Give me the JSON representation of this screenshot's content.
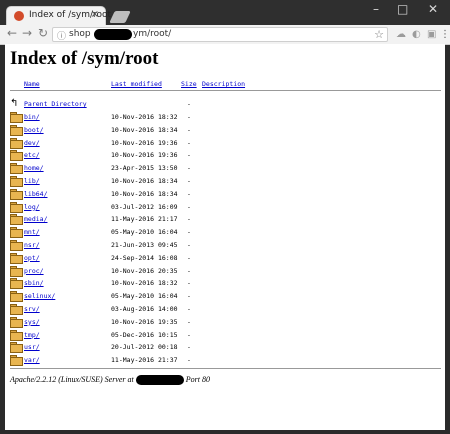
{
  "browser": {
    "tab_title": "Index of /sym/root",
    "tab_close": "×",
    "url_prefix": "shop",
    "url_suffix": "ym/root/",
    "nav": {
      "back": "←",
      "forward": "→",
      "reload": "↻"
    },
    "window_controls": {
      "minimize": "–",
      "maximize": "□",
      "close": "✕"
    }
  },
  "page": {
    "title": "Index of /sym/root",
    "columns": {
      "name": "Name",
      "modified": "Last modified",
      "size": "Size",
      "description": "Description"
    },
    "parent": {
      "name": "Parent Directory",
      "size": "-"
    },
    "entries": [
      {
        "name": "bin/",
        "modified": "10-Nov-2016 18:32",
        "size": "-"
      },
      {
        "name": "boot/",
        "modified": "10-Nov-2016 18:34",
        "size": "-"
      },
      {
        "name": "dev/",
        "modified": "10-Nov-2016 19:36",
        "size": "-"
      },
      {
        "name": "etc/",
        "modified": "10-Nov-2016 19:36",
        "size": "-"
      },
      {
        "name": "home/",
        "modified": "23-Apr-2015 13:50",
        "size": "-"
      },
      {
        "name": "lib/",
        "modified": "10-Nov-2016 18:34",
        "size": "-"
      },
      {
        "name": "lib64/",
        "modified": "10-Nov-2016 18:34",
        "size": "-"
      },
      {
        "name": "log/",
        "modified": "03-Jul-2012 16:09",
        "size": "-"
      },
      {
        "name": "media/",
        "modified": "11-May-2016 21:17",
        "size": "-"
      },
      {
        "name": "mnt/",
        "modified": "05-May-2010 16:04",
        "size": "-"
      },
      {
        "name": "nsr/",
        "modified": "21-Jun-2013 09:45",
        "size": "-"
      },
      {
        "name": "opt/",
        "modified": "24-Sep-2014 16:08",
        "size": "-"
      },
      {
        "name": "proc/",
        "modified": "10-Nov-2016 20:35",
        "size": "-"
      },
      {
        "name": "sbin/",
        "modified": "10-Nov-2016 18:32",
        "size": "-"
      },
      {
        "name": "selinux/",
        "modified": "05-May-2010 16:04",
        "size": "-"
      },
      {
        "name": "srv/",
        "modified": "03-Aug-2016 14:00",
        "size": "-"
      },
      {
        "name": "sys/",
        "modified": "10-Nov-2016 19:35",
        "size": "-"
      },
      {
        "name": "tmp/",
        "modified": "05-Dec-2016 10:15",
        "size": "-"
      },
      {
        "name": "usr/",
        "modified": "20-Jul-2012 00:18",
        "size": "-"
      },
      {
        "name": "var/",
        "modified": "11-May-2016 21:37",
        "size": "-"
      }
    ],
    "footer_prefix": "Apache/2.2.12 (Linux/SUSE) Server at",
    "footer_suffix": "Port 80"
  }
}
